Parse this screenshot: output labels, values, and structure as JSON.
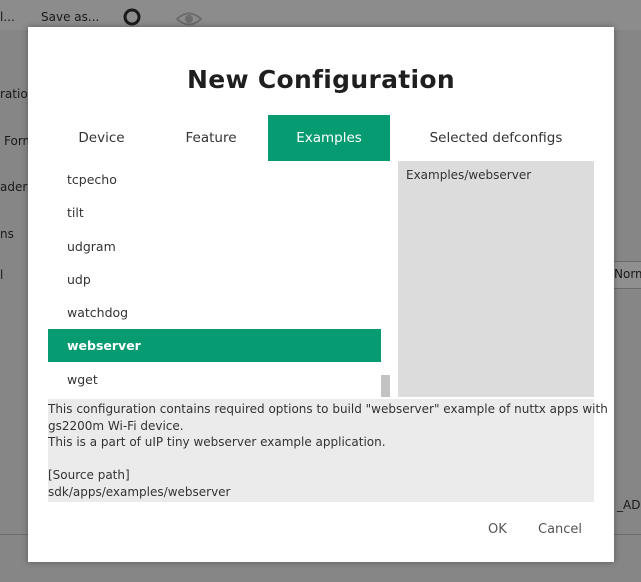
{
  "background": {
    "menu": "l...",
    "save_as": "Save as...",
    "side_labels": [
      "ration",
      "Form",
      "ader",
      "ns",
      "l"
    ],
    "right_labels": [
      "Norm",
      "_ADD"
    ]
  },
  "dialog": {
    "title": "New Configuration",
    "tabs": [
      {
        "label": "Device",
        "active": false
      },
      {
        "label": "Feature",
        "active": false
      },
      {
        "label": "Examples",
        "active": true
      },
      {
        "label": "Selected defconfigs",
        "active": false
      }
    ],
    "examples": [
      "tcpecho",
      "tilt",
      "udgram",
      "udp",
      "watchdog",
      "webserver",
      "wget"
    ],
    "selected_example": "webserver",
    "selected_defconfigs": [
      "Examples/webserver"
    ],
    "description_lines": [
      "This configuration contains required options to build \"webserver\" example of nuttx apps with",
      "gs2200m Wi-Fi device.",
      "This is a part of uIP tiny webserver example application.",
      "",
      "[Source path]",
      "sdk/apps/examples/webserver"
    ],
    "ok_label": "OK",
    "cancel_label": "Cancel"
  },
  "colors": {
    "accent": "#079b72",
    "overlay": "#868686"
  }
}
